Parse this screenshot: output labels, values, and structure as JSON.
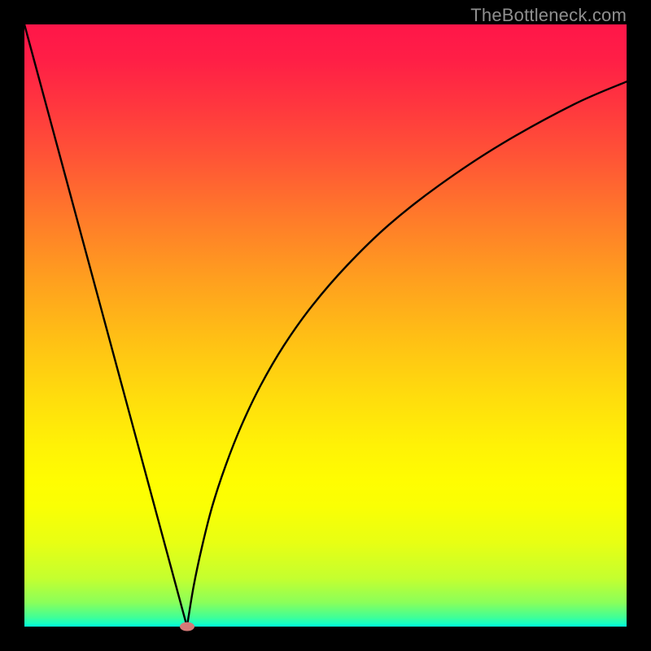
{
  "watermark": "TheBottleneck.com",
  "colors": {
    "curve": "#000000",
    "marker": "#d57a78",
    "frame": "#000000"
  },
  "chart_data": {
    "type": "line",
    "title": "",
    "xlabel": "",
    "ylabel": "",
    "xlim": [
      0,
      100
    ],
    "ylim": [
      0,
      100
    ],
    "grid": false,
    "legend": false,
    "note": "No axis ticks or numeric labels are rendered in the image; values below are estimated from pixel positions on a 0–100 normalized scale (origin bottom-left).",
    "series": [
      {
        "name": "left-branch",
        "x": [
          0.0,
          2.7,
          5.4,
          8.1,
          10.8,
          13.5,
          16.2,
          18.9,
          21.6,
          24.3,
          27.0
        ],
        "y": [
          100.0,
          90.0,
          80.0,
          70.0,
          60.0,
          50.0,
          40.0,
          30.0,
          20.0,
          10.0,
          0.0
        ]
      },
      {
        "name": "right-branch",
        "x": [
          27.0,
          28.1,
          29.5,
          31.2,
          33.4,
          36.0,
          39.2,
          43.1,
          47.8,
          53.6,
          60.5,
          68.9,
          79.0,
          91.2,
          100.0
        ],
        "y": [
          0.0,
          6.7,
          13.3,
          20.0,
          26.7,
          33.3,
          40.0,
          46.7,
          53.3,
          60.0,
          66.7,
          73.3,
          80.0,
          86.7,
          90.5
        ]
      }
    ],
    "marker": {
      "x": 27.0,
      "y": 0.0
    },
    "minimum_x": 27.0
  }
}
